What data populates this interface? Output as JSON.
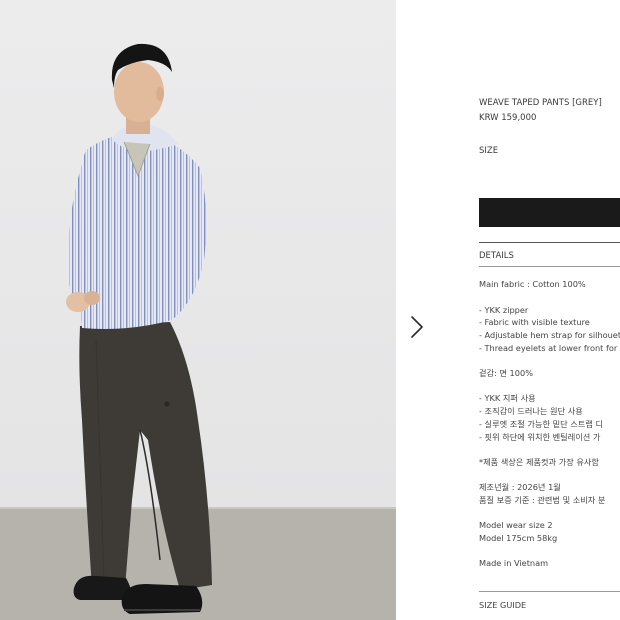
{
  "product": {
    "title": "WEAVE TAPED PANTS [GREY]",
    "price": "KRW 159,000",
    "size_label": "SIZE",
    "details_label": "DETAILS",
    "size_guide_label": "SIZE GUIDE"
  },
  "details": {
    "lines": [
      "Main fabric : Cotton 100%",
      "- YKK zipper",
      "- Fabric with visible texture",
      "- Adjustable hem strap for silhouett",
      "- Thread eyelets at lower front for ve",
      "겉감: 면 100%",
      "- YKK 지퍼 사용",
      "- 조직감이 드러나는 원단 사용",
      "- 실루엣 조절 가능한 밑단 스트랩 디",
      "- 핏위 하단에 위치한 벤틸레이션 가",
      "*제품 색상은 제품컷과 가장 유사함",
      "제조년월 : 2026년 1월",
      "품질 보증 기준 : 관련법 및 소비자 분",
      "Model wear size 2",
      "Model 175cm 58kg",
      "Made in Vietnam"
    ]
  },
  "icons": {
    "next": "chevron-right-icon"
  },
  "colors": {
    "button": "#1a1a1a",
    "background": "#ffffff",
    "photo_background": "#ebebec",
    "floor": "#b6b3ad"
  }
}
